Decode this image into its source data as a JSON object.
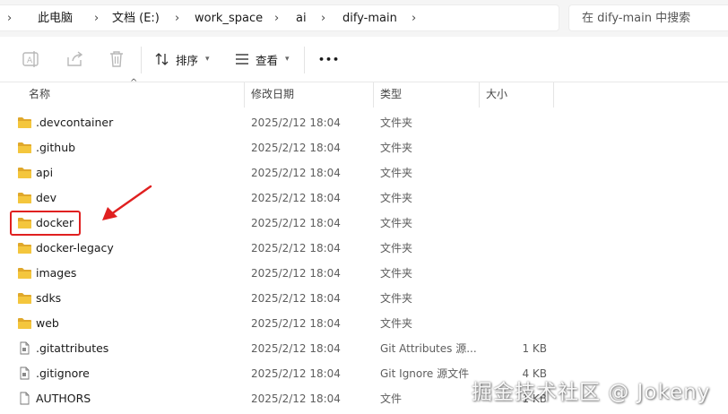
{
  "breadcrumbs": [
    "此电脑",
    "文档 (E:)",
    "work_space",
    "ai",
    "dify-main"
  ],
  "search": {
    "placeholder": "在 dify-main 中搜索"
  },
  "toolbar": {
    "sort_label": "排序",
    "view_label": "查看",
    "more_label": "•••"
  },
  "columns": {
    "name": "名称",
    "date": "修改日期",
    "type": "类型",
    "size": "大小"
  },
  "files": [
    {
      "name": ".devcontainer",
      "date": "2025/2/12 18:04",
      "type": "文件夹",
      "size": "",
      "icon": "folder-icon"
    },
    {
      "name": ".github",
      "date": "2025/2/12 18:04",
      "type": "文件夹",
      "size": "",
      "icon": "folder-icon"
    },
    {
      "name": "api",
      "date": "2025/2/12 18:04",
      "type": "文件夹",
      "size": "",
      "icon": "folder-icon"
    },
    {
      "name": "dev",
      "date": "2025/2/12 18:04",
      "type": "文件夹",
      "size": "",
      "icon": "folder-icon"
    },
    {
      "name": "docker",
      "date": "2025/2/12 18:04",
      "type": "文件夹",
      "size": "",
      "icon": "folder-icon"
    },
    {
      "name": "docker-legacy",
      "date": "2025/2/12 18:04",
      "type": "文件夹",
      "size": "",
      "icon": "folder-icon"
    },
    {
      "name": "images",
      "date": "2025/2/12 18:04",
      "type": "文件夹",
      "size": "",
      "icon": "folder-icon"
    },
    {
      "name": "sdks",
      "date": "2025/2/12 18:04",
      "type": "文件夹",
      "size": "",
      "icon": "folder-icon"
    },
    {
      "name": "web",
      "date": "2025/2/12 18:04",
      "type": "文件夹",
      "size": "",
      "icon": "folder-icon"
    },
    {
      "name": ".gitattributes",
      "date": "2025/2/12 18:04",
      "type": "Git Attributes 源...",
      "size": "1 KB",
      "icon": "file-icon"
    },
    {
      "name": ".gitignore",
      "date": "2025/2/12 18:04",
      "type": "Git Ignore 源文件",
      "size": "4 KB",
      "icon": "file-icon"
    },
    {
      "name": "AUTHORS",
      "date": "2025/2/12 18:04",
      "type": "文件",
      "size": "1 KB",
      "icon": "blank-file-icon"
    }
  ],
  "watermark": "掘金技术社区 @ Jokeny",
  "colors": {
    "folder": "#f4c63d",
    "folder_dark": "#e0a82b",
    "annotation": "#e02020"
  }
}
